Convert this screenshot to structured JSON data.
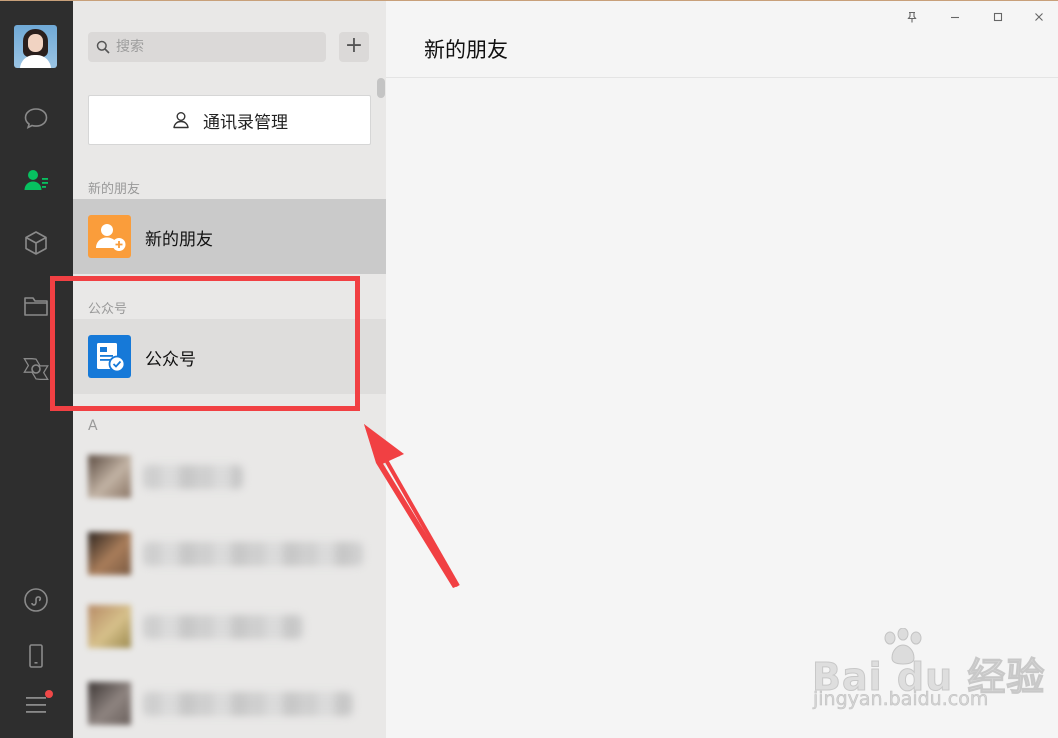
{
  "window": {
    "controls": {
      "pin": "pin-icon",
      "minimize": "minimize-icon",
      "maximize": "maximize-icon",
      "close": "close-icon"
    }
  },
  "rail": {
    "icons": [
      "chat-icon",
      "contacts-icon",
      "favorites-cube-icon",
      "folder-icon",
      "moments-icon",
      "mini-program-icon",
      "phone-icon",
      "menu-icon"
    ],
    "active": "contacts-icon",
    "accent": "#07c160"
  },
  "list": {
    "search": {
      "placeholder": "搜索"
    },
    "add_label": "+",
    "manage_button": {
      "label": "通讯录管理"
    },
    "sections": {
      "new_friends_title": "新的朋友",
      "new_friends_item": "新的朋友",
      "official_title": "公众号",
      "official_item": "公众号",
      "letter_a": "A"
    },
    "colors": {
      "new_friends_icon": "#fa9d3b",
      "official_icon": "#1679d8"
    }
  },
  "content": {
    "title": "新的朋友"
  },
  "annotation": {
    "color": "#f14043"
  },
  "watermark": {
    "main": "Bai du 经验",
    "sub": "jingyan.baidu.com"
  }
}
